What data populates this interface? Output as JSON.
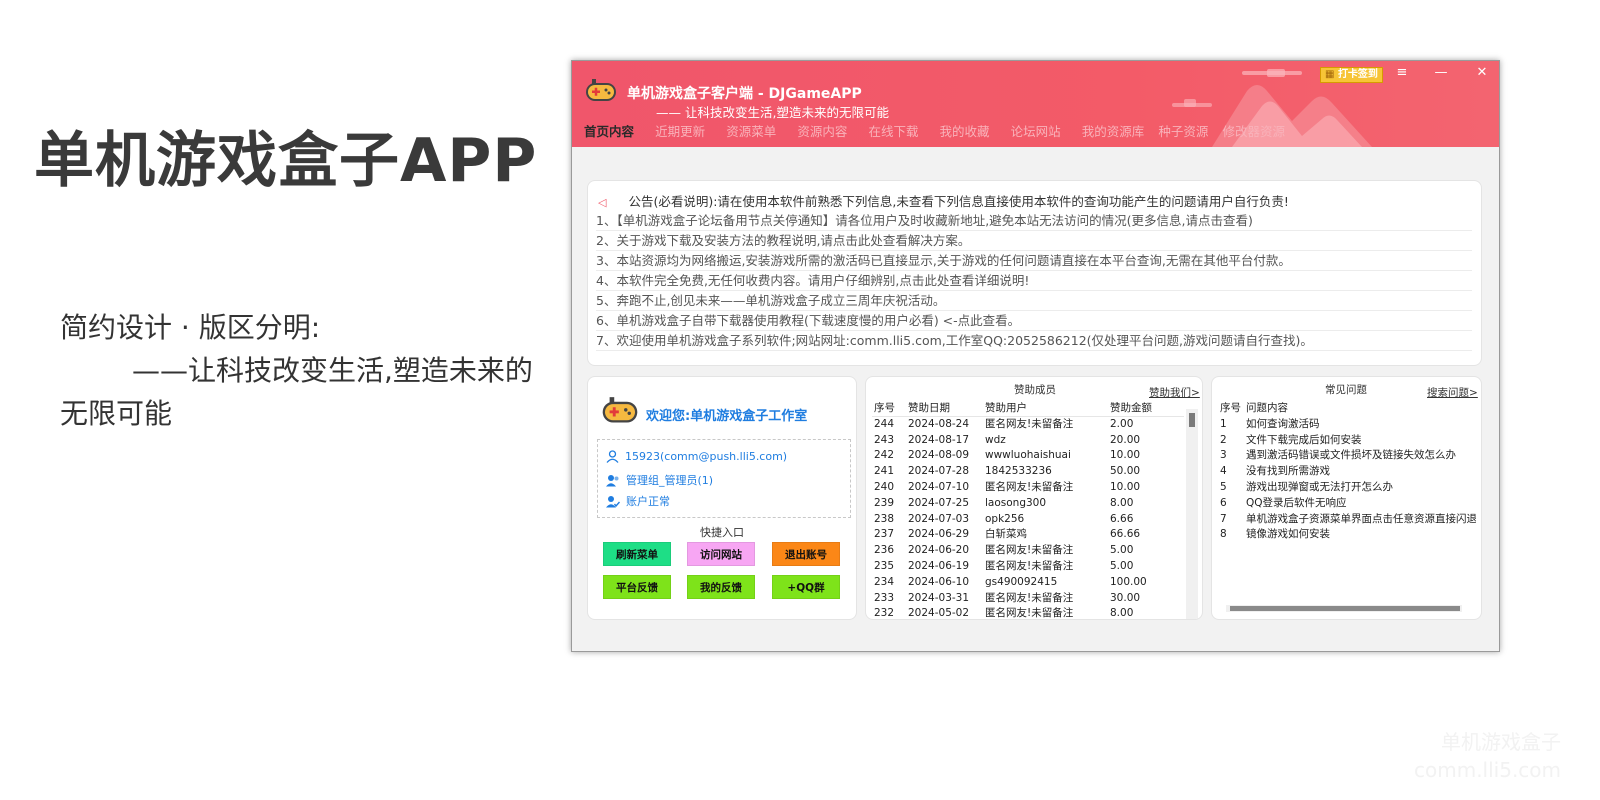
{
  "slide": {
    "title": "单机游戏盒子APP",
    "subtitle_line1": "简约设计 · 版区分明:",
    "subtitle_line2": "——让科技改变生活,塑造未来的无限可能"
  },
  "window": {
    "title": "单机游戏盒子客户端 - DJGameAPP",
    "slogan": "—— 让科技改变生活,塑造未来的无限可能",
    "checkin_label": "打卡签到",
    "controls": {
      "settings": "≡",
      "minimize": "—",
      "close": "✕"
    },
    "accent_color": "#f35b68",
    "nav": [
      {
        "label": "首页内容",
        "active": true
      },
      {
        "label": "近期更新"
      },
      {
        "label": "资源菜单"
      },
      {
        "label": "资源内容"
      },
      {
        "label": "在线下载"
      },
      {
        "label": "我的收藏"
      },
      {
        "label": "论坛网站"
      },
      {
        "label": "我的资源库"
      },
      {
        "label": "种子资源"
      },
      {
        "label": "修改器资源"
      }
    ]
  },
  "notice": {
    "header": "公告(必看说明):请在使用本软件前熟悉下列信息,未查看下列信息直接使用本软件的查询功能产生的问题请用户自行负责!",
    "lines": [
      "1、【单机游戏盒子论坛备用节点关停通知】请各位用户及时收藏新地址,避免本站无法访问的情况(更多信息,请点击查看)",
      "2、关于游戏下载及安装方法的教程说明,请点击此处查看解决方案。",
      "3、本站资源均为网络搬运,安装游戏所需的激活码已直接显示,关于游戏的任何问题请直接在本平台查询,无需在其他平台付款。",
      "4、本软件完全免费,无任何收费内容。请用户仔细辨别,点击此处查看详细说明!",
      "5、奔跑不止,创见未来——单机游戏盒子成立三周年庆祝活动。",
      "6、单机游戏盒子自带下载器使用教程(下载速度慢的用户必看) <-点此查看。",
      "7、欢迎使用单机游戏盒子系列软件;网站网址:comm.lli5.com,工作室QQ:2052586212(仅处理平台问题,游戏问题请自行查找)。"
    ]
  },
  "user": {
    "welcome": "欢迎您:单机游戏盒子工作室",
    "account": "15923(comm@push.lli5.com)",
    "group": "管理组_管理员(1)",
    "status": "账户正常",
    "quick_title": "快捷入口",
    "buttons": [
      {
        "label": "刷新菜单",
        "color": "#1ede86"
      },
      {
        "label": "访问网站",
        "color": "#f7a6f3"
      },
      {
        "label": "退出账号",
        "color": "#fb8717"
      },
      {
        "label": "平台反馈",
        "color": "#7ee31a"
      },
      {
        "label": "我的反馈",
        "color": "#7ee31a"
      },
      {
        "label": "+QQ群",
        "color": "#7ee31a"
      }
    ]
  },
  "sponsors": {
    "title": "赞助成员",
    "link": "赞助我们>",
    "columns": [
      "序号",
      "赞助日期",
      "赞助用户",
      "赞助金额"
    ],
    "rows": [
      [
        "244",
        "2024-08-24",
        "匿名网友!未留备注",
        "2.00"
      ],
      [
        "243",
        "2024-08-17",
        "wdz",
        "20.00"
      ],
      [
        "242",
        "2024-08-09",
        "wwwluohaishuai",
        "10.00"
      ],
      [
        "241",
        "2024-07-28",
        "1842533236",
        "50.00"
      ],
      [
        "240",
        "2024-07-10",
        "匿名网友!未留备注",
        "10.00"
      ],
      [
        "239",
        "2024-07-25",
        "laosong300",
        "8.00"
      ],
      [
        "238",
        "2024-07-03",
        "opk256",
        "6.66"
      ],
      [
        "237",
        "2024-06-29",
        "白斩菜鸡",
        "66.66"
      ],
      [
        "236",
        "2024-06-20",
        "匿名网友!未留备注",
        "5.00"
      ],
      [
        "235",
        "2024-06-19",
        "匿名网友!未留备注",
        "5.00"
      ],
      [
        "234",
        "2024-06-10",
        "gs490092415",
        "100.00"
      ],
      [
        "233",
        "2024-03-31",
        "匿名网友!未留备注",
        "30.00"
      ],
      [
        "232",
        "2024-05-02",
        "匿名网友!未留备注",
        "8.00"
      ]
    ]
  },
  "faq": {
    "title": "常见问题",
    "link": "搜索问题>",
    "columns": [
      "序号",
      "问题内容"
    ],
    "rows": [
      [
        "1",
        "如何查询激活码"
      ],
      [
        "2",
        "文件下载完成后如何安装"
      ],
      [
        "3",
        "遇到激活码错误或文件损坏及链接失效怎么办"
      ],
      [
        "4",
        "没有找到所需游戏"
      ],
      [
        "5",
        "游戏出现弹窗或无法打开怎么办"
      ],
      [
        "6",
        "QQ登录后软件无响应"
      ],
      [
        "7",
        "单机游戏盒子资源菜单界面点击任意资源直接闪退"
      ],
      [
        "8",
        "镜像游戏如何安装"
      ]
    ]
  },
  "watermark": {
    "line1": "单机游戏盒子",
    "line2": "comm.lli5.com"
  }
}
